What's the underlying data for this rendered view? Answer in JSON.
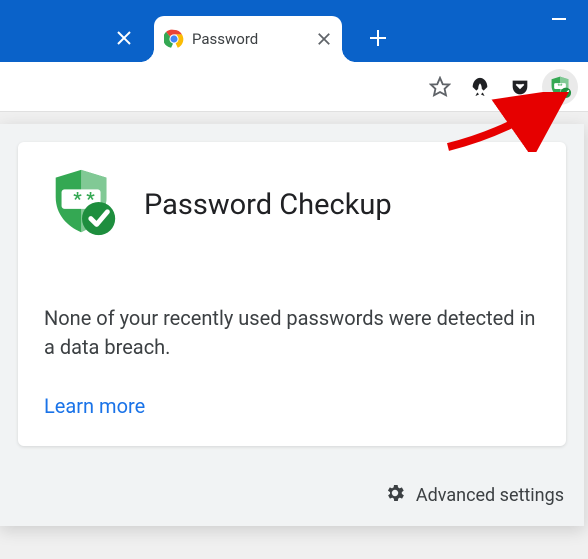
{
  "tab": {
    "title": "Password"
  },
  "popup": {
    "title": "Password Checkup",
    "body": "None of your recently used passwords were detected in a data breach.",
    "learn_more": "Learn more",
    "advanced": "Advanced settings"
  }
}
